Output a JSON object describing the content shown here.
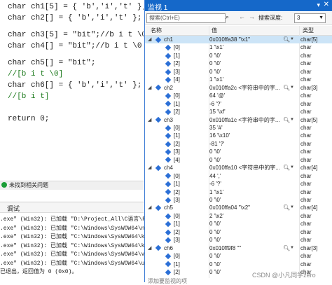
{
  "editor": {
    "lines": [
      {
        "text": "char ch1[5] = { 'b','i','t' };",
        "kind": "code"
      },
      {
        "text": "char ch2[] = { 'b','i','t' };",
        "kind": "code"
      },
      {
        "text": "char ch3[5] = \"bit\";//b i t \\0 0",
        "kind": "code"
      },
      {
        "text": "char ch4[] = \"bit\";//b i t \\0",
        "kind": "code"
      },
      {
        "text": "char ch5[] = \"bit\";",
        "kind": "code"
      },
      {
        "text": "//[b i t \\0]",
        "kind": "comment"
      },
      {
        "text": "char ch6[] = { 'b','i','t' };",
        "kind": "code"
      },
      {
        "text": "//[b i t]",
        "kind": "comment"
      },
      {
        "text": "return 0;",
        "kind": "code"
      }
    ]
  },
  "status": {
    "text": "未找到相关问题"
  },
  "output": {
    "tab": "调试",
    "lines": [
      ".exe\" (Win32): 已加载 \"D:\\Project_All\\C语言\\Pr",
      ".exe\" (Win32): 已加载 \"C:\\Windows\\SysWOW64\\ntd",
      ".exe\" (Win32): 已加载 \"C:\\Windows\\SysWOW64\\kern",
      ".exe\" (Win32): 已加载 \"C:\\Windows\\SysWOW64\\kern",
      ".exe\" (Win32): 已加载 \"C:\\Windows\\SysWOW64\\vcru",
      ".exe\" (Win32): 已加载 \"C:\\Windows\\SysWOW64\\ucrt",
      "已退出，返回值为 0 (0x0)。"
    ]
  },
  "watch": {
    "title": "监视 1",
    "search_placeholder": "搜索(Ctrl+E)",
    "depth_label": "搜索深度:",
    "depth_value": "3",
    "columns": {
      "name": "名称",
      "value": "值",
      "type": "类型"
    },
    "rows": [
      {
        "level": 0,
        "name": "ch1",
        "value": "0x010ffa38 \"\\x1\"",
        "type": "char[5]",
        "expanded": true,
        "selected": true,
        "tools": true
      },
      {
        "level": 1,
        "name": "[0]",
        "value": "1 '\\x1'",
        "type": "char"
      },
      {
        "level": 1,
        "name": "[1]",
        "value": "0 '\\0'",
        "type": "char"
      },
      {
        "level": 1,
        "name": "[2]",
        "value": "0 '\\0'",
        "type": "char"
      },
      {
        "level": 1,
        "name": "[3]",
        "value": "0 '\\0'",
        "type": "char"
      },
      {
        "level": 1,
        "name": "[4]",
        "value": "1 '\\x1'",
        "type": "char"
      },
      {
        "level": 0,
        "name": "ch2",
        "value": "0x010ffa2c <字符串中的字...",
        "type": "char[3]",
        "expanded": true,
        "tools": true
      },
      {
        "level": 1,
        "name": "[0]",
        "value": "64 '@'",
        "type": "char"
      },
      {
        "level": 1,
        "name": "[1]",
        "value": "-6 '?'",
        "type": "char"
      },
      {
        "level": 1,
        "name": "[2]",
        "value": "15 '\\xf'",
        "type": "char"
      },
      {
        "level": 0,
        "name": "ch3",
        "value": "0x010ffa1c <字符串中的字...",
        "type": "char[5]",
        "expanded": true,
        "tools": true
      },
      {
        "level": 1,
        "name": "[0]",
        "value": "35 '#'",
        "type": "char"
      },
      {
        "level": 1,
        "name": "[1]",
        "value": "16 '\\x10'",
        "type": "char"
      },
      {
        "level": 1,
        "name": "[2]",
        "value": "-81 '?'",
        "type": "char"
      },
      {
        "level": 1,
        "name": "[3]",
        "value": "0 '\\0'",
        "type": "char"
      },
      {
        "level": 1,
        "name": "[4]",
        "value": "0 '\\0'",
        "type": "char"
      },
      {
        "level": 0,
        "name": "ch4",
        "value": "0x010ffa10 <字符串中的字...",
        "type": "char[4]",
        "expanded": true,
        "tools": true
      },
      {
        "level": 1,
        "name": "[0]",
        "value": "44 ','",
        "type": "char"
      },
      {
        "level": 1,
        "name": "[1]",
        "value": "-6 '?'",
        "type": "char"
      },
      {
        "level": 1,
        "name": "[2]",
        "value": "1 '\\x1'",
        "type": "char"
      },
      {
        "level": 1,
        "name": "[3]",
        "value": "0 '\\0'",
        "type": "char"
      },
      {
        "level": 0,
        "name": "ch5",
        "value": "0x010ffa04 \"\\x2\"",
        "type": "char[4]",
        "expanded": true,
        "tools": true
      },
      {
        "level": 1,
        "name": "[0]",
        "value": "2 '\\x2'",
        "type": "char"
      },
      {
        "level": 1,
        "name": "[1]",
        "value": "0 '\\0'",
        "type": "char"
      },
      {
        "level": 1,
        "name": "[2]",
        "value": "0 '\\0'",
        "type": "char"
      },
      {
        "level": 1,
        "name": "[3]",
        "value": "0 '\\0'",
        "type": "char"
      },
      {
        "level": 0,
        "name": "ch6",
        "value": "0x010ff9f8 \"\"",
        "type": "char[3]",
        "expanded": true,
        "tools": true
      },
      {
        "level": 1,
        "name": "[0]",
        "value": "0 '\\0'",
        "type": "char"
      },
      {
        "level": 1,
        "name": "[1]",
        "value": "0 '\\0'",
        "type": "char"
      },
      {
        "level": 1,
        "name": "[2]",
        "value": "0 '\\0'",
        "type": "char"
      }
    ],
    "footer_hint": "添加要监视的项"
  },
  "watermark": "CSDN @小凡同学zero",
  "colors": {
    "title_bar": "#1568c9",
    "selection": "#cce4f7",
    "comment": "#1e7b1e"
  }
}
